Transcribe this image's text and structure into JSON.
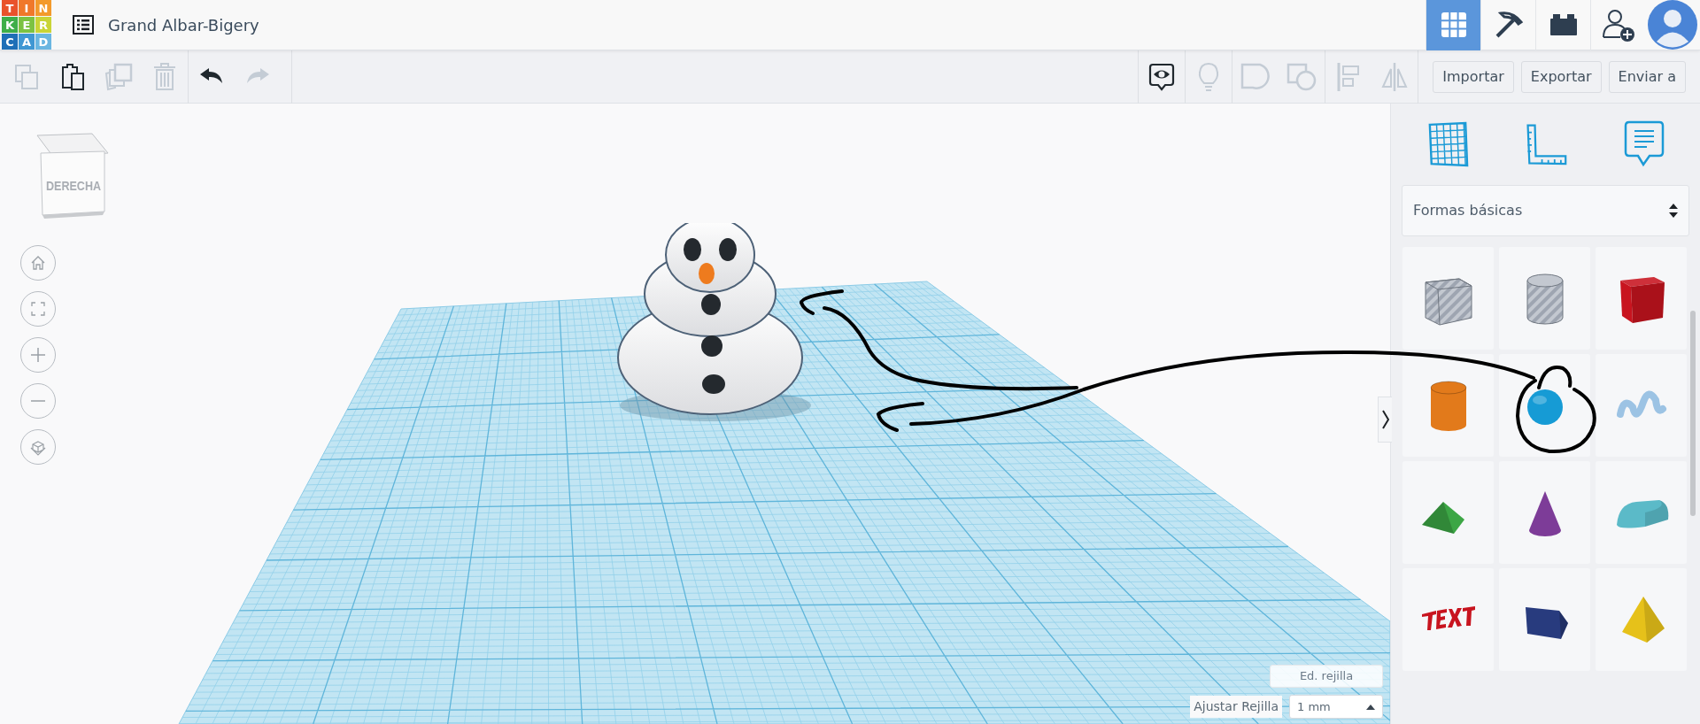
{
  "app": {
    "logo": [
      {
        "letter": "T",
        "color": "#e9532b"
      },
      {
        "letter": "I",
        "color": "#f0782a"
      },
      {
        "letter": "N",
        "color": "#f39a2b"
      },
      {
        "letter": "K",
        "color": "#3fae49"
      },
      {
        "letter": "E",
        "color": "#7cc242"
      },
      {
        "letter": "R",
        "color": "#c9d437"
      },
      {
        "letter": "C",
        "color": "#1f6fb7"
      },
      {
        "letter": "A",
        "color": "#3f97d3"
      },
      {
        "letter": "D",
        "color": "#6ab6e1"
      }
    ],
    "title": "Grand Albar-Bigery"
  },
  "top_nav": [
    {
      "kind": "grid",
      "selected": true
    },
    {
      "kind": "pickaxe",
      "selected": false
    },
    {
      "kind": "bricks",
      "selected": false
    },
    {
      "kind": "add-user",
      "selected": false
    }
  ],
  "toolbar_left": [
    {
      "kind": "copy",
      "disabled": true
    },
    {
      "kind": "paste",
      "disabled": false
    },
    {
      "kind": "duplicate",
      "disabled": true
    },
    {
      "kind": "delete",
      "disabled": true
    },
    {
      "kind": "undo",
      "disabled": false
    },
    {
      "kind": "redo",
      "disabled": true
    }
  ],
  "toolbar_right": [
    {
      "kind": "notes",
      "disabled": false
    },
    {
      "kind": "bulb",
      "disabled": true
    },
    {
      "kind": "group",
      "disabled": true
    },
    {
      "kind": "ungroup",
      "disabled": true
    },
    {
      "kind": "align",
      "disabled": true
    },
    {
      "kind": "mirror",
      "disabled": true
    }
  ],
  "toolbar_buttons": [
    "Importar",
    "Exportar",
    "Enviar a"
  ],
  "view_cube": {
    "front_label": "DERECHA"
  },
  "panel": {
    "category": "Formas básicas",
    "shapes": [
      {
        "kind": "box-hole",
        "color": "#c3c8d0"
      },
      {
        "kind": "cylinder-hole",
        "color": "#c3c8d0"
      },
      {
        "kind": "box",
        "color": "#c8141f"
      },
      {
        "kind": "cylinder",
        "color": "#e27a1b"
      },
      {
        "kind": "sphere",
        "color": "#169bd5"
      },
      {
        "kind": "scribble",
        "color": "#9cc3e4"
      },
      {
        "kind": "roof",
        "color": "#3ca645"
      },
      {
        "kind": "cone",
        "color": "#7d3c98"
      },
      {
        "kind": "round-roof",
        "color": "#5bbac8"
      },
      {
        "kind": "text",
        "color": "#c8141f"
      },
      {
        "kind": "polygon",
        "color": "#283b7e"
      },
      {
        "kind": "pyramid",
        "color": "#e6c11a"
      }
    ]
  },
  "grid_controls": {
    "edit_button": "Ed. rejilla",
    "snap_label": "Ajustar Rejilla",
    "snap_value": "1 mm"
  }
}
